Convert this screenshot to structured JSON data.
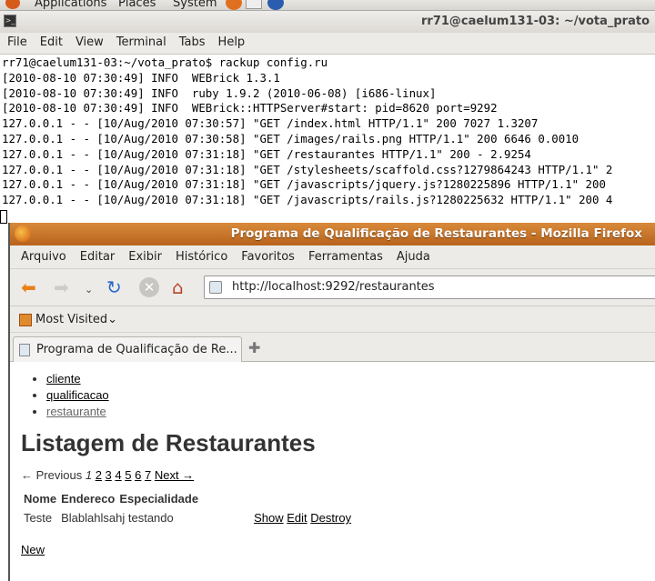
{
  "panel": {
    "items": [
      "Applications",
      "Places",
      "System"
    ]
  },
  "terminal": {
    "title": "rr71@caelum131-03: ~/vota_prato",
    "menu": [
      "File",
      "Edit",
      "View",
      "Terminal",
      "Tabs",
      "Help"
    ],
    "lines": [
      "rr71@caelum131-03:~/vota_prato$ rackup config.ru",
      "[2010-08-10 07:30:49] INFO  WEBrick 1.3.1",
      "[2010-08-10 07:30:49] INFO  ruby 1.9.2 (2010-06-08) [i686-linux]",
      "[2010-08-10 07:30:49] INFO  WEBrick::HTTPServer#start: pid=8620 port=9292",
      "127.0.0.1 - - [10/Aug/2010 07:30:57] \"GET /index.html HTTP/1.1\" 200 7027 1.3207",
      "127.0.0.1 - - [10/Aug/2010 07:30:58] \"GET /images/rails.png HTTP/1.1\" 200 6646 0.0010",
      "127.0.0.1 - - [10/Aug/2010 07:31:18] \"GET /restaurantes HTTP/1.1\" 200 - 2.9254",
      "127.0.0.1 - - [10/Aug/2010 07:31:18] \"GET /stylesheets/scaffold.css?1279864243 HTTP/1.1\" 2",
      "127.0.0.1 - - [10/Aug/2010 07:31:18] \"GET /javascripts/jquery.js?1280225896 HTTP/1.1\" 200",
      "127.0.0.1 - - [10/Aug/2010 07:31:18] \"GET /javascripts/rails.js?1280225632 HTTP/1.1\" 200 4"
    ]
  },
  "firefox": {
    "title": "Programa de Qualificação de Restaurantes - Mozilla Firefox",
    "menu": [
      "Arquivo",
      "Editar",
      "Exibir",
      "Histórico",
      "Favoritos",
      "Ferramentas",
      "Ajuda"
    ],
    "url": "http://localhost:9292/restaurantes",
    "bookmark": "Most Visited",
    "tab": "Programa de Qualificação de Re...",
    "page": {
      "nav": [
        "cliente",
        "qualificacao",
        "restaurante"
      ],
      "heading": "Listagem de Restaurantes",
      "pagination": {
        "previous": "← Previous",
        "current": "1",
        "pages": [
          "2",
          "3",
          "4",
          "5",
          "6",
          "7"
        ],
        "next": "Next →"
      },
      "columns": [
        "Nome",
        "Endereco",
        "Especialidade"
      ],
      "rows": [
        {
          "nome": "Teste",
          "endereco": "Blablahlsahj",
          "especialidade": "testando",
          "actions": [
            "Show",
            "Edit",
            "Destroy"
          ]
        }
      ],
      "new_link": "New"
    }
  }
}
